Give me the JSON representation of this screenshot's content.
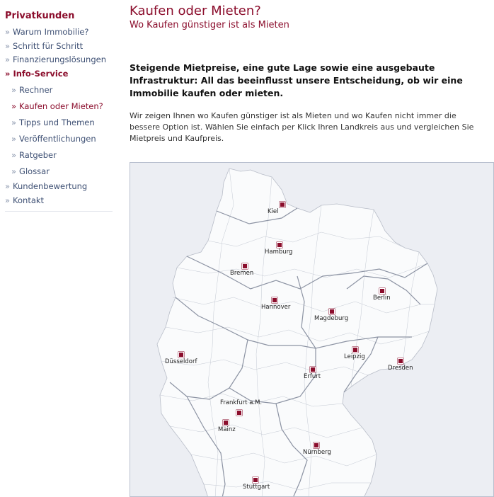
{
  "sidebar": {
    "title": "Privatkunden",
    "items": [
      {
        "label": "Warum Immobilie?"
      },
      {
        "label": "Schritt für Schritt"
      },
      {
        "label": "Finanzierungslösungen"
      },
      {
        "label": "Info-Service"
      },
      {
        "label": "Rechner"
      },
      {
        "label": "Kaufen oder Mieten?"
      },
      {
        "label": "Tipps und Themen"
      },
      {
        "label": "Veröffentlichungen"
      },
      {
        "label": "Ratgeber"
      },
      {
        "label": "Glossar"
      },
      {
        "label": "Kundenbewertung"
      },
      {
        "label": "Kontakt"
      }
    ],
    "arrow": "»"
  },
  "main": {
    "title": "Kaufen oder Mieten?",
    "subtitle": "Wo Kaufen günstiger ist als Mieten",
    "lead": "Steigende Mietpreise, eine gute Lage sowie eine ausgebaute Infrastruktur: All das beeinflusst unsere Entscheidung, ob wir eine Immobilie kaufen oder mieten.",
    "text": "Wir zeigen Ihnen wo Kaufen günstiger ist als Mieten und wo Kaufen nicht immer die bessere Option ist. Wählen Sie einfach per Klick Ihren Landkreis aus und vergleichen Sie Mietpreis und Kaufpreis."
  },
  "map": {
    "cities": [
      "Kiel",
      "Hamburg",
      "Bremen",
      "Berlin",
      "Hannover",
      "Magdeburg",
      "Leipzig",
      "Düsseldorf",
      "Dresden",
      "Erfurt",
      "Frankfurt a.M.",
      "Mainz",
      "Nürnberg",
      "Stuttgart"
    ]
  },
  "colors": {
    "accent": "#8b0d2c",
    "nav": "#3d4f73",
    "map_bg": "#eceef3"
  }
}
